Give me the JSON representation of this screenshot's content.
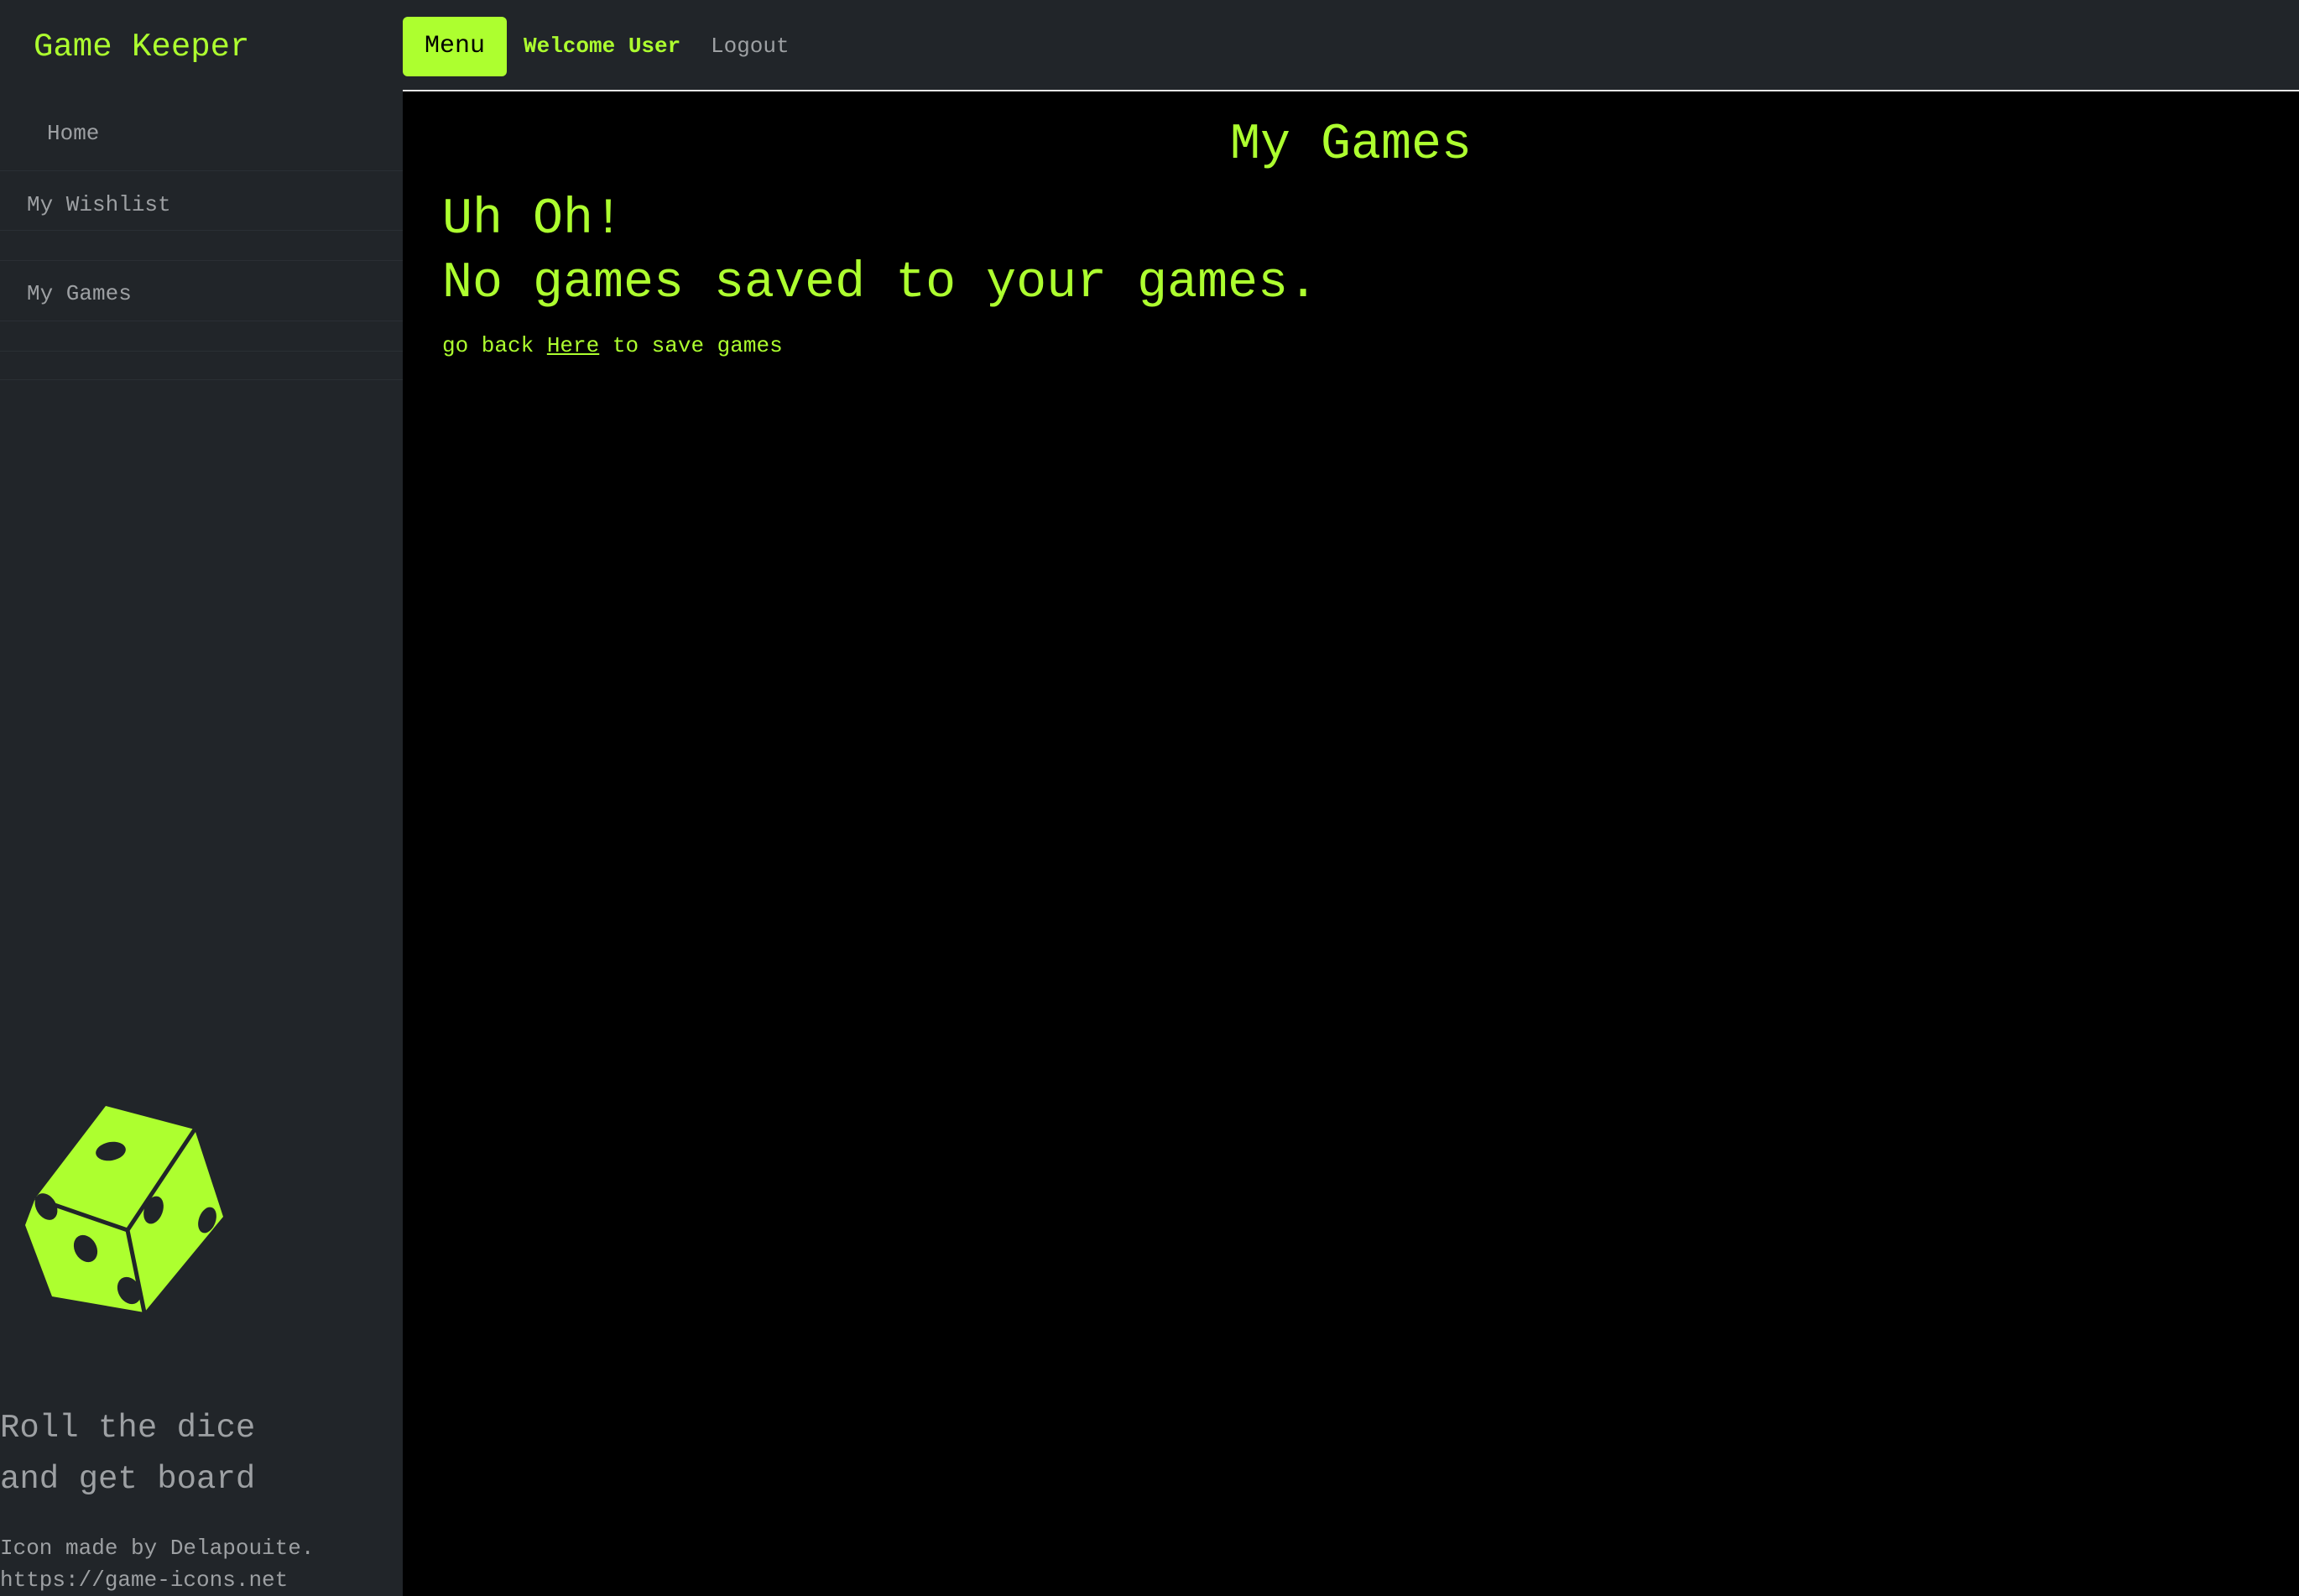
{
  "sidebar": {
    "brand": "Game Keeper",
    "items": [
      {
        "label": "Home"
      },
      {
        "label": "My Wishlist"
      },
      {
        "label": "My Games"
      }
    ],
    "dice_icon": "dice-icon",
    "tagline_line1": "Roll the dice",
    "tagline_line2": "and get board",
    "credit_line1": "Icon made by Delapouite.",
    "credit_line2": "https://game-icons.net"
  },
  "header": {
    "menu_label": "Menu",
    "welcome": "Welcome User",
    "logout": "Logout"
  },
  "main": {
    "title": "My Games",
    "heading_line1": "Uh Oh!",
    "heading_line2": "No games saved to your games.",
    "back_prefix": "go back",
    "back_link": "Here",
    "back_suffix": "to save games"
  },
  "colors": {
    "accent": "#adff2f",
    "sidebar_bg": "#212529",
    "content_bg": "#000000",
    "muted_text": "#9da0a3"
  }
}
